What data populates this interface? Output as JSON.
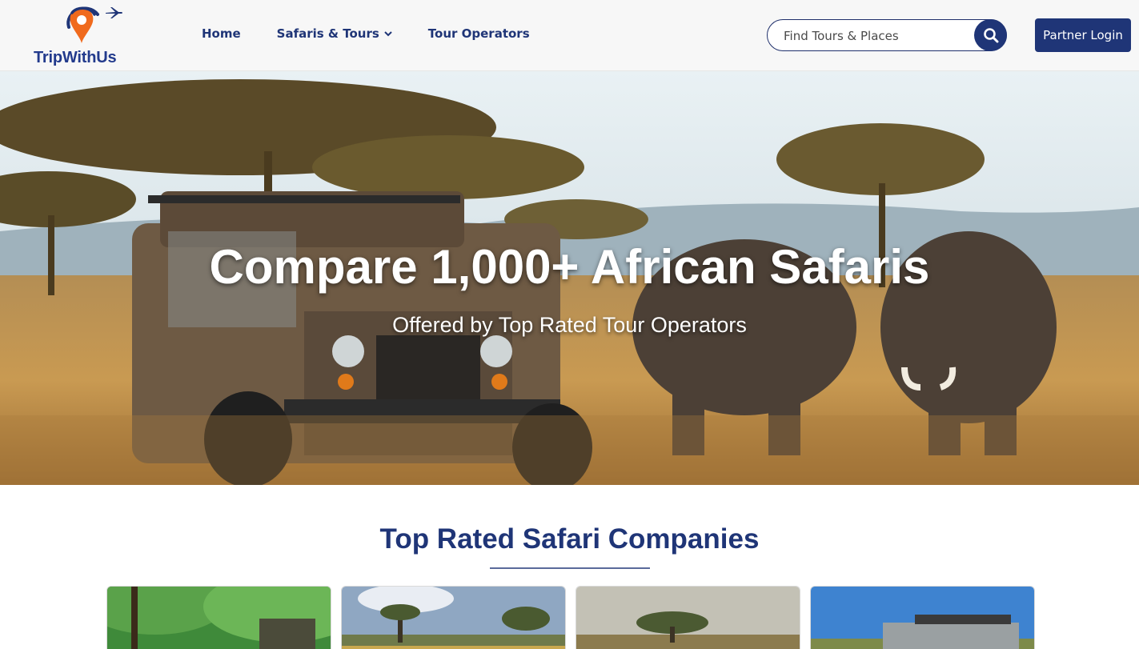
{
  "brand": {
    "name": "TripWithUs",
    "logo_icon": "map-pin-with-plane-icon",
    "colors": {
      "navy": "#1f3577",
      "orange": "#f06a1d"
    }
  },
  "nav": {
    "items": [
      {
        "label": "Home"
      },
      {
        "label": "Safaris & Tours",
        "has_dropdown": true
      },
      {
        "label": "Tour Operators"
      }
    ]
  },
  "search": {
    "placeholder": "Find Tours & Places",
    "icon": "search-icon"
  },
  "header_actions": {
    "partner_login_label": "Partner Login"
  },
  "hero": {
    "title": "Compare 1,000+ African Safaris",
    "subtitle": "Offered by Top Rated Tour Operators",
    "image_subject": "safari-jeep-and-elephants"
  },
  "companies_section": {
    "title": "Top Rated Safari Companies",
    "cards": [
      {
        "image": "forest-safari-vehicle"
      },
      {
        "image": "savanna-lodge-trees"
      },
      {
        "image": "acacia-tree-savanna"
      },
      {
        "image": "safari-land-cruiser"
      }
    ]
  }
}
